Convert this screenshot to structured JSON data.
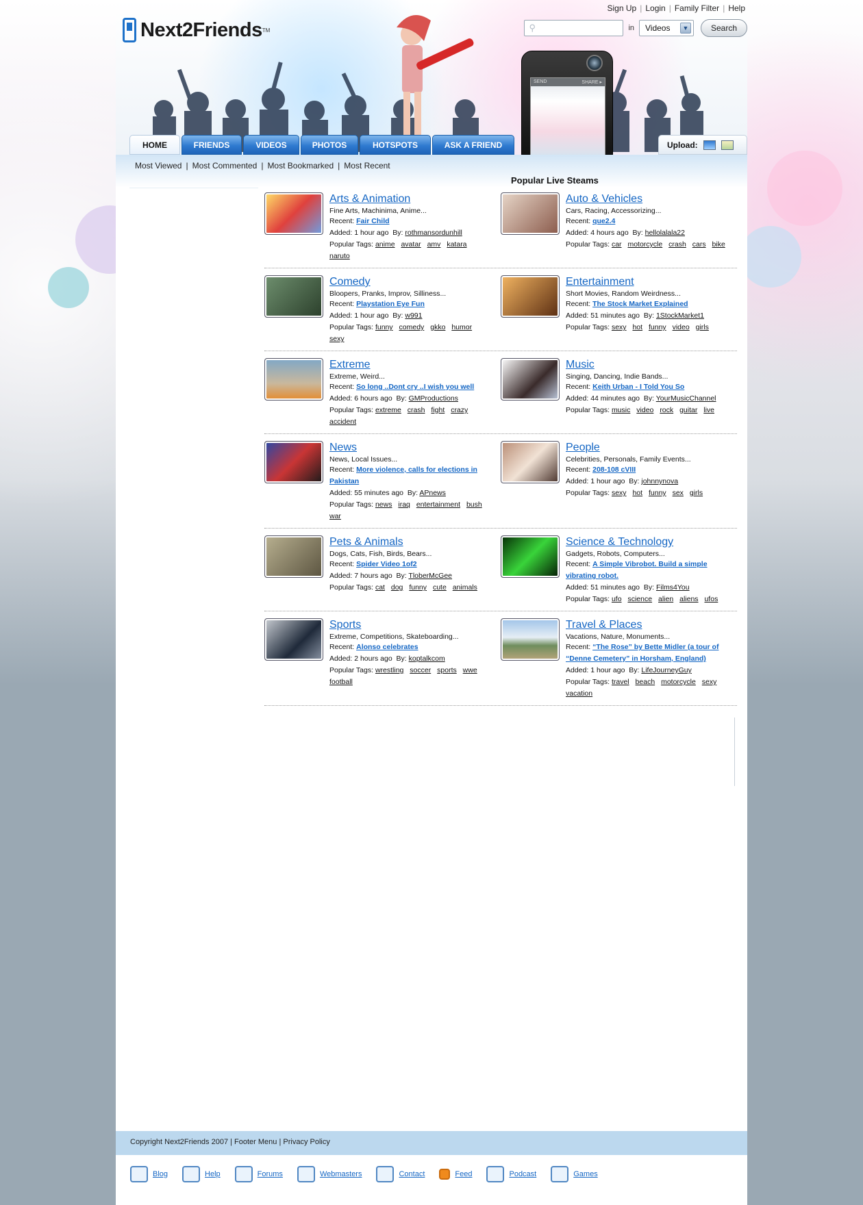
{
  "brand": {
    "name": "Next2Friends",
    "tm": "TM"
  },
  "top_links": [
    "Sign Up",
    "Login",
    "Family Filter",
    "Help"
  ],
  "search": {
    "placeholder": "",
    "in_label": "in",
    "scope": "Videos",
    "button": "Search"
  },
  "phone_screen": {
    "send": "SEND",
    "share": "SHARE ▸"
  },
  "nav": {
    "tabs": [
      "HOME",
      "FRIENDS",
      "VIDEOS",
      "PHOTOS",
      "HOTSPOTS",
      "ASK A FRIEND"
    ],
    "active": "HOME",
    "upload_label": "Upload:"
  },
  "subnav": [
    "Most Viewed",
    "Most Commented",
    "Most Bookmarked",
    "Most Recent"
  ],
  "section_title": "Popular Live Steams",
  "labels": {
    "recent": "Recent:",
    "added": "Added:",
    "by": "By:",
    "popular_tags": "Popular Tags:"
  },
  "categories": [
    {
      "title": "Arts & Animation",
      "desc": "Fine Arts, Machinima, Anime...",
      "recent": "Fair Child",
      "added": "1 hour ago",
      "by": "rothmansordunhill",
      "tags": [
        "anime",
        "avatar",
        "amv",
        "katara",
        "naruto"
      ]
    },
    {
      "title": "Auto & Vehicles",
      "desc": "Cars, Racing, Accessorizing...",
      "recent": "que2.4",
      "added": "4 hours ago",
      "by": "hellolalala22",
      "tags": [
        "car",
        "motorcycle",
        "crash",
        "cars",
        "bike"
      ]
    },
    {
      "title": "Comedy",
      "desc": "Bloopers, Pranks, Improv, Silliness...",
      "recent": "Playstation Eye Fun",
      "added": "1 hour ago",
      "by": "w991",
      "tags": [
        "funny",
        "comedy",
        "gkko",
        "humor",
        "sexy"
      ]
    },
    {
      "title": "Entertainment",
      "desc": "Short Movies, Random Weirdness...",
      "recent": "The Stock Market Explained",
      "added": "51 minutes ago",
      "by": "1StockMarket1",
      "tags": [
        "sexy",
        "hot",
        "funny",
        "video",
        "girls"
      ]
    },
    {
      "title": "Extreme",
      "desc": "Extreme, Weird...",
      "recent": "So long ..Dont cry ..I wish you well",
      "added": "6 hours ago",
      "by": "GMProductions",
      "tags": [
        "extreme",
        "crash",
        "fight",
        "crazy",
        "accident"
      ]
    },
    {
      "title": "Music",
      "desc": "Singing, Dancing, Indie Bands...",
      "recent": "Keith Urban - I Told You So",
      "added": "44 minutes ago",
      "by": "YourMusicChannel",
      "tags": [
        "music",
        "video",
        "rock",
        "guitar",
        "live"
      ]
    },
    {
      "title": "News",
      "desc": "News, Local Issues...",
      "recent": "More violence, calls for elections in Pakistan",
      "added": "55 minutes ago",
      "by": "APnews",
      "tags": [
        "news",
        "iraq",
        "entertainment",
        "bush",
        "war"
      ]
    },
    {
      "title": "People",
      "desc": "Celebrities, Personals, Family Events...",
      "recent": "208-108 cVIII",
      "added": "1 hour ago",
      "by": "johnnynova",
      "tags": [
        "sexy",
        "hot",
        "funny",
        "sex",
        "girls"
      ]
    },
    {
      "title": "Pets & Animals",
      "desc": "Dogs, Cats, Fish, Birds, Bears...",
      "recent": "Spider Video 1of2",
      "added": "7 hours ago",
      "by": "TloberMcGee",
      "tags": [
        "cat",
        "dog",
        "funny",
        "cute",
        "animals"
      ]
    },
    {
      "title": "Science & Technology",
      "desc": "Gadgets, Robots, Computers...",
      "recent": "A Simple Vibrobot. Build a simple vibrating robot.",
      "added": "51 minutes ago",
      "by": "Films4You",
      "tags": [
        "ufo",
        "science",
        "alien",
        "aliens",
        "ufos"
      ]
    },
    {
      "title": "Sports",
      "desc": "Extreme, Competitions, Skateboarding...",
      "recent": "Alonso celebrates",
      "added": "2 hours ago",
      "by": "koptalkcom",
      "tags": [
        "wrestling",
        "soccer",
        "sports",
        "wwe",
        "football"
      ]
    },
    {
      "title": "Travel & Places",
      "desc": "Vacations, Nature, Monuments...",
      "recent": "“The Rose” by Bette Midler (a tour of “Denne Cemetery” in Horsham, England)",
      "added": "1 hour ago",
      "by": "LifeJourneyGuy",
      "tags": [
        "travel",
        "beach",
        "motorcycle",
        "sexy",
        "vacation"
      ]
    }
  ],
  "footer": {
    "copyright": "Copyright Next2Friends 2007 | Footer Menu | Privacy Policy",
    "links": [
      {
        "label": "Blog",
        "icon": "blog-icon"
      },
      {
        "label": "Help",
        "icon": "gears-icon"
      },
      {
        "label": "Forums",
        "icon": "speech-bubbles-icon"
      },
      {
        "label": "Webmasters",
        "icon": "cursor-icon"
      },
      {
        "label": "Contact",
        "icon": "envelope-icon"
      },
      {
        "label": "Feed",
        "icon": "rss-icon"
      },
      {
        "label": "Podcast",
        "icon": "ipod-icon"
      },
      {
        "label": "Games",
        "icon": "game-icon"
      }
    ]
  },
  "colors": {
    "link": "#1466c4",
    "tab": "#2f7ad0",
    "footer_bar": "#bcd8ee",
    "page_bg": "#9aa8b3"
  }
}
